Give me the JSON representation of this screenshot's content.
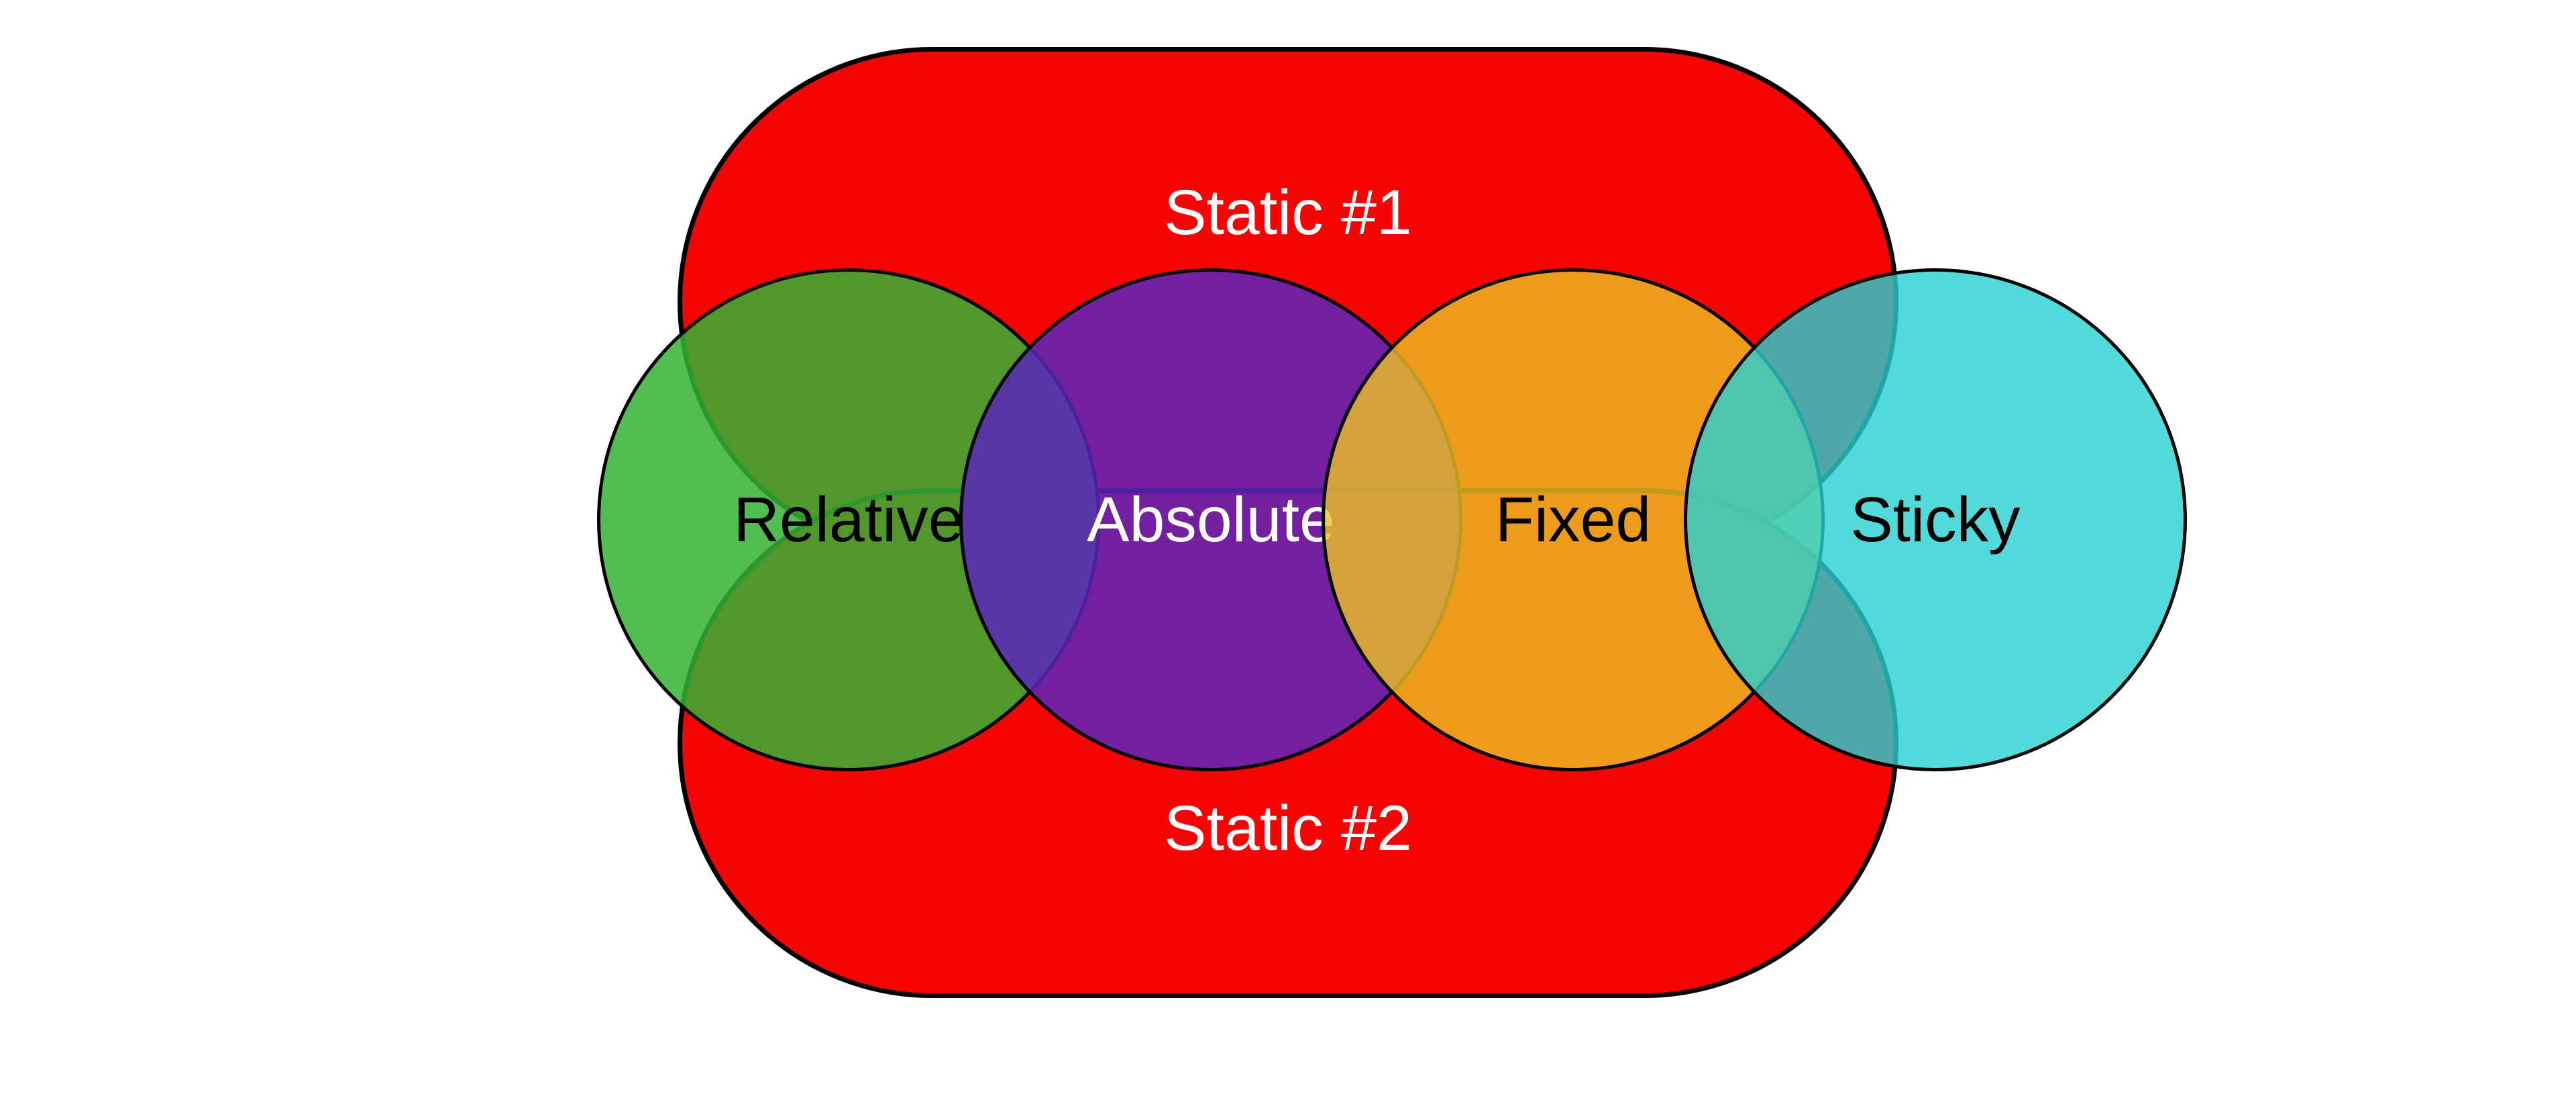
{
  "static": {
    "top_label": "Static #1",
    "bottom_label": "Static #2"
  },
  "circles": {
    "relative": "Relative",
    "absolute": "Absolute",
    "fixed": "Fixed",
    "sticky": "Sticky"
  },
  "colors": {
    "panel": "#f60304",
    "relative": "#34b233",
    "absolute": "#5b24bc",
    "fixed": "#ecc223",
    "sticky": "#27d1d1"
  }
}
